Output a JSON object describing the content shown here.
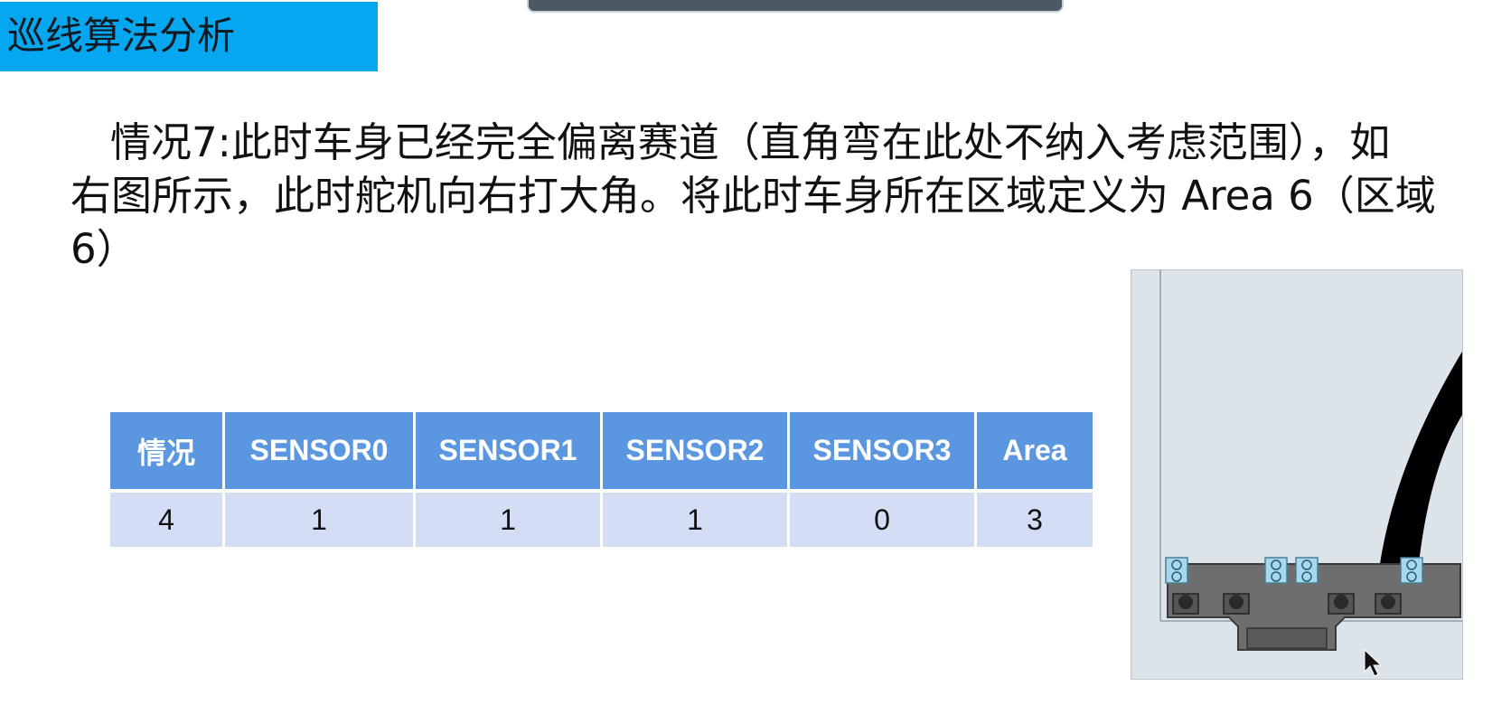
{
  "slide": {
    "title": "巡线算法分析",
    "body_lines": [
      "情况7:此时车身已经完全偏离赛道（直角弯在此处不纳入考虑范围），如",
      "右图所示，此时舵机向右打大角。将此时车身所在区域定义为 Area 6（区域",
      "6）"
    ]
  },
  "table": {
    "headers": [
      "情况",
      "SENSOR0",
      "SENSOR1",
      "SENSOR2",
      "SENSOR3",
      "Area"
    ],
    "rows": [
      [
        "4",
        "1",
        "1",
        "1",
        "0",
        "3"
      ]
    ]
  },
  "figure": {
    "icons": [
      "track-curve",
      "sensor-board",
      "mouse-cursor-icon"
    ],
    "colors": {
      "background": "#dde5eb",
      "track": "#000000",
      "board": "#6e6e6e",
      "sensor": "#a6d8ee"
    }
  }
}
